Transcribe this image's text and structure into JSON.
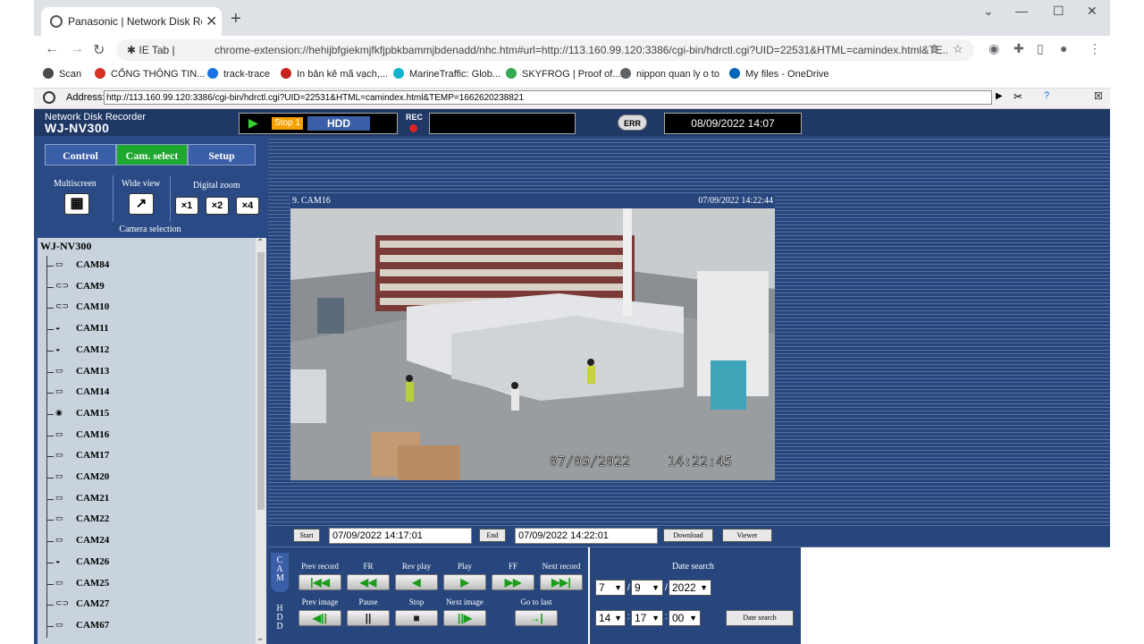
{
  "browser": {
    "tab_title": "Panasonic | Network Disk Recorder",
    "extension_label": "IE Tab",
    "url": "chrome-extension://hehijbfgiekmjfkfjpbkbammjbdenadd/nhc.htm#url=http://113.160.99.120:3386/cgi-bin/hdrctl.cgi?UID=22531&HTML=camindex.html&TE...",
    "bookmarks": [
      {
        "label": "Scan",
        "color": "#4a4a4a"
      },
      {
        "label": "CỔNG THÔNG TIN...",
        "color": "#d93025"
      },
      {
        "label": "track-trace",
        "color": "#1a73e8"
      },
      {
        "label": "In bản kê mã vạch,...",
        "color": "#c5221f"
      },
      {
        "label": "MarineTraffic: Glob...",
        "color": "#12b5cb"
      },
      {
        "label": "SKYFROG | Proof of...",
        "color": "#34a853"
      },
      {
        "label": "nippon quan ly o to",
        "color": "#5f6368"
      },
      {
        "label": "My files - OneDrive",
        "color": "#0364b8"
      }
    ]
  },
  "address_bar": {
    "label": "Address:",
    "value": "http://113.160.99.120:3386/cgi-bin/hdrctl.cgi?UID=22531&HTML=camindex.html&TEMP=1662620238821"
  },
  "nvr": {
    "brand_line1": "Network Disk Recorder",
    "brand_line2": "WJ-NV300",
    "status_stop": "Stop 1",
    "status_hdd": "HDD",
    "rec_label": "REC",
    "err_label": "ERR",
    "datetime": "08/09/2022  14:07",
    "tabs": {
      "control": "Control",
      "cam_select": "Cam. select",
      "setup": "Setup"
    },
    "multiscreen_label": "Multiscreen",
    "wideview_label": "Wide view",
    "digitalzoom_label": "Digital zoom",
    "zoom": [
      "×1",
      "×2",
      "×4"
    ],
    "camera_selection_label": "Camera selection",
    "tree_root": "WJ-NV300",
    "cameras": [
      {
        "label": "CAM84",
        "icon": "box-camera"
      },
      {
        "label": "CAM9",
        "icon": "bullet-camera"
      },
      {
        "label": "CAM10",
        "icon": "bullet-camera"
      },
      {
        "label": "CAM11",
        "icon": "dome-camera"
      },
      {
        "label": "CAM12",
        "icon": "dome-camera"
      },
      {
        "label": "CAM13",
        "icon": "box-camera"
      },
      {
        "label": "CAM14",
        "icon": "box-camera"
      },
      {
        "label": "CAM15",
        "icon": "fisheye-camera"
      },
      {
        "label": "CAM16",
        "icon": "box-camera"
      },
      {
        "label": "CAM17",
        "icon": "box-camera"
      },
      {
        "label": "CAM20",
        "icon": "box-camera"
      },
      {
        "label": "CAM21",
        "icon": "box-camera"
      },
      {
        "label": "CAM22",
        "icon": "box-camera"
      },
      {
        "label": "CAM24",
        "icon": "box-camera"
      },
      {
        "label": "CAM26",
        "icon": "dome-camera"
      },
      {
        "label": "CAM25",
        "icon": "box-camera"
      },
      {
        "label": "CAM27",
        "icon": "bullet-camera"
      },
      {
        "label": "CAM67",
        "icon": "box-camera"
      }
    ],
    "video": {
      "channel_label": "9. CAM16",
      "timestamp_header": "07/09/2022 14:22:44",
      "osd_date": "07/09/2022",
      "osd_time": "14:22:45"
    },
    "download_bar": {
      "start_label": "Start",
      "start_value": "07/09/2022  14:17:01",
      "end_label": "End",
      "end_value": "07/09/2022  14:22:01",
      "download_label": "Download",
      "viewer_label": "Viewer"
    },
    "side_tabs": {
      "cam": "CAM",
      "hdd": "HDD"
    },
    "playback": {
      "row1": [
        {
          "label": "Prev record",
          "glyph": "|◀◀"
        },
        {
          "label": "FR",
          "glyph": "◀◀"
        },
        {
          "label": "Rev play",
          "glyph": "◀"
        },
        {
          "label": "Play",
          "glyph": "▶"
        },
        {
          "label": "FF",
          "glyph": "▶▶"
        },
        {
          "label": "Next record",
          "glyph": "▶▶|"
        }
      ],
      "row2": [
        {
          "label": "Prev image",
          "glyph": "◀||"
        },
        {
          "label": "Pause",
          "glyph": "||"
        },
        {
          "label": "Stop",
          "glyph": "■"
        },
        {
          "label": "Next image",
          "glyph": "||▶"
        },
        {
          "label": "Go to last",
          "glyph": "→|"
        }
      ]
    },
    "date_search": {
      "title": "Date search",
      "month": "7",
      "day": "9",
      "year": "2022",
      "hour": "14",
      "minute": "17",
      "second": "00",
      "button": "Date search"
    }
  }
}
